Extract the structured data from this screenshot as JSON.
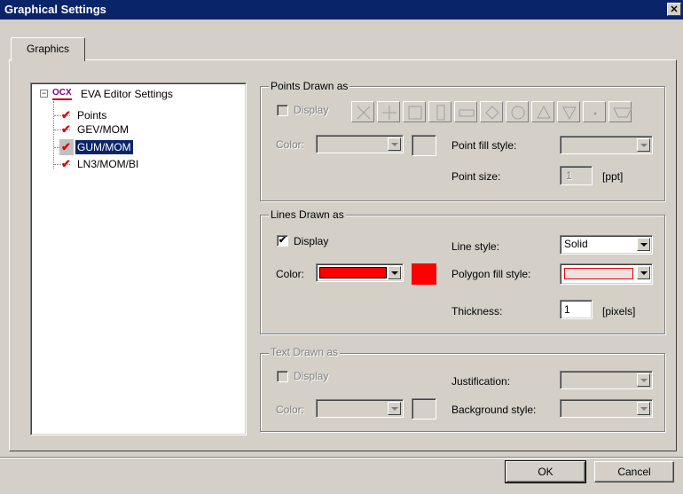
{
  "window": {
    "title": "Graphical Settings",
    "close_glyph": "✕"
  },
  "tabs": [
    {
      "label": "Graphics"
    }
  ],
  "tree": {
    "root": {
      "badge": "OCX",
      "label": "EVA Editor Settings",
      "expander": "−"
    },
    "items": [
      {
        "label": "Points",
        "checked": true,
        "selected": false
      },
      {
        "label": "GEV/MOM",
        "checked": true,
        "selected": false
      },
      {
        "label": "GUM/MOM",
        "checked": true,
        "selected": true
      },
      {
        "label": "LN3/MOM/BI",
        "checked": true,
        "selected": false
      }
    ],
    "check_glyph": "✔"
  },
  "points_group": {
    "title": "Points Drawn as",
    "display_label": "Display",
    "display_checked": false,
    "color_label": "Color:",
    "fill_style_label": "Point fill style:",
    "size_label": "Point size:",
    "size_value": "1",
    "size_unit": "[ppt]",
    "shapes": [
      "x-cross",
      "plus",
      "square",
      "tall-rect",
      "wide-rect",
      "diamond",
      "circle",
      "triangle-up",
      "triangle-down",
      "dot",
      "trapezoid"
    ]
  },
  "lines_group": {
    "title": "Lines Drawn as",
    "display_label": "Display",
    "display_checked": true,
    "check_mark": "✔",
    "color_label": "Color:",
    "color_value": "#ff0000",
    "line_style_label": "Line style:",
    "line_style_value": "Solid",
    "polygon_fill_label": "Polygon fill style:",
    "thickness_label": "Thickness:",
    "thickness_value": "1",
    "thickness_unit": "[pixels]"
  },
  "text_group": {
    "title": "Text Drawn as",
    "display_label": "Display",
    "display_checked": false,
    "color_label": "Color:",
    "justification_label": "Justification:",
    "background_label": "Background style:"
  },
  "buttons": {
    "ok": "OK",
    "cancel": "Cancel"
  },
  "colors": {
    "selection": "#0a246a",
    "check": "#e00000",
    "accent_red": "#ff0000",
    "face": "#d4d0c8"
  }
}
